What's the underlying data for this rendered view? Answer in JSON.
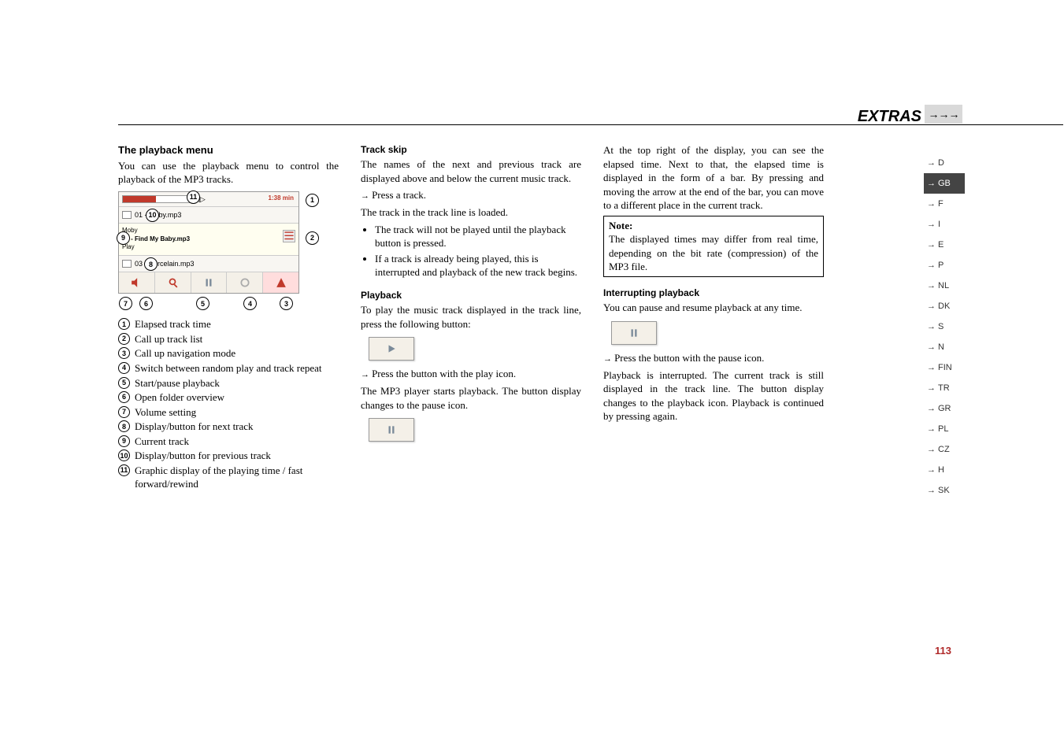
{
  "header": {
    "title": "EXTRAS",
    "arrows": "→→→"
  },
  "col1": {
    "h3": "The playback menu",
    "intro": "You can use the playback menu to control the playback of the MP3 tracks.",
    "screenshot": {
      "time": "1:38 min",
      "track1": "01 - Moby.mp3",
      "track2_top": "Moby",
      "track2_main": "02 - Find My Baby.mp3",
      "track2_bot": "Play",
      "track3": "03 - Porcelain.mp3",
      "callouts": [
        "11",
        "1",
        "10",
        "9",
        "2",
        "8",
        "7",
        "6",
        "5",
        "4",
        "3"
      ]
    },
    "legend": [
      {
        "n": "1",
        "t": "Elapsed track time"
      },
      {
        "n": "2",
        "t": "Call up track list"
      },
      {
        "n": "3",
        "t": "Call up navigation mode"
      },
      {
        "n": "4",
        "t": "Switch between random play and track repeat"
      },
      {
        "n": "5",
        "t": "Start/pause playback"
      },
      {
        "n": "6",
        "t": "Open folder overview"
      },
      {
        "n": "7",
        "t": "Volume setting"
      },
      {
        "n": "8",
        "t": "Display/button for next track"
      },
      {
        "n": "9",
        "t": "Current track"
      },
      {
        "n": "10",
        "t": "Display/button for previous track"
      },
      {
        "n": "11",
        "t": "Graphic display of the playing time / fast forward/rewind"
      }
    ]
  },
  "col2": {
    "h_trackskip": "Track skip",
    "p1": "The names of the next and previous track are displayed above and below the current music track.",
    "p2": "Press a track.",
    "p3": "The track in the track line is loaded.",
    "bullets": [
      "The track will not be played until the playback button is pressed.",
      "If a track is already being played, this is interrupted and playback of the new track begins."
    ],
    "h_playback": "Playback",
    "p4": "To play the music track displayed in the track line, press the following button:",
    "p5": "Press the button with the play icon.",
    "p6": "The MP3 player starts playback. The button display changes to the pause icon."
  },
  "col3": {
    "p1": "At the top right of the display, you can see the elapsed time. Next to that, the elapsed time is displayed in the form of a bar. By pressing and moving the arrow at the end of the bar, you can move to a different place in the current track.",
    "note_label": "Note:",
    "note_body": "The displayed times may differ from real time, depending on the bit rate (compression) of the MP3 file.",
    "h_interrupt": "Interrupting playback",
    "p2": "You can pause and resume playback at any time.",
    "p3": "Press the button with the pause icon.",
    "p4": "Playback is interrupted. The current track is still displayed in the track line. The button display changes to the playback icon. Playback is continued by pressing again."
  },
  "sidebar": [
    "D",
    "GB",
    "F",
    "I",
    "E",
    "P",
    "NL",
    "DK",
    "S",
    "N",
    "FIN",
    "TR",
    "GR",
    "PL",
    "CZ",
    "H",
    "SK"
  ],
  "sidebar_active": "GB",
  "page_number": "113"
}
